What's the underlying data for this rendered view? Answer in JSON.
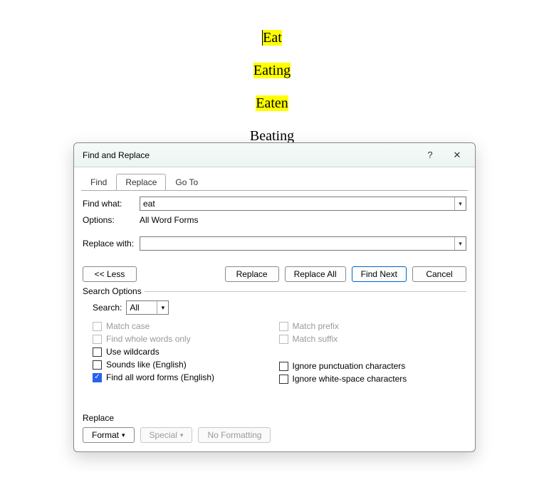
{
  "document": {
    "word1": "Eat",
    "word2": "Eating",
    "word3": "Eaten",
    "word4": "Beating"
  },
  "dialog": {
    "title": "Find and Replace",
    "help": "?",
    "close": "✕",
    "tabs": {
      "find": "Find",
      "replace": "Replace",
      "goto": "Go To"
    },
    "find_label": "Find what:",
    "find_value": "eat",
    "options_label": "Options:",
    "options_value": "All Word Forms",
    "replace_label": "Replace with:",
    "replace_value": "",
    "buttons": {
      "less": "<< Less",
      "replace": "Replace",
      "replace_all": "Replace All",
      "find_next": "Find Next",
      "cancel": "Cancel"
    },
    "search_options_legend": "Search Options",
    "search_label": "Search:",
    "search_value": "All",
    "checks": {
      "match_case": "Match case",
      "whole_words": "Find whole words only",
      "wildcards": "Use wildcards",
      "sounds_like": "Sounds like (English)",
      "word_forms": "Find all word forms (English)",
      "match_prefix": "Match prefix",
      "match_suffix": "Match suffix",
      "ignore_punct": "Ignore punctuation characters",
      "ignore_ws": "Ignore white-space characters"
    },
    "replace_section": {
      "header": "Replace",
      "format": "Format",
      "special": "Special",
      "no_formatting": "No Formatting"
    }
  }
}
